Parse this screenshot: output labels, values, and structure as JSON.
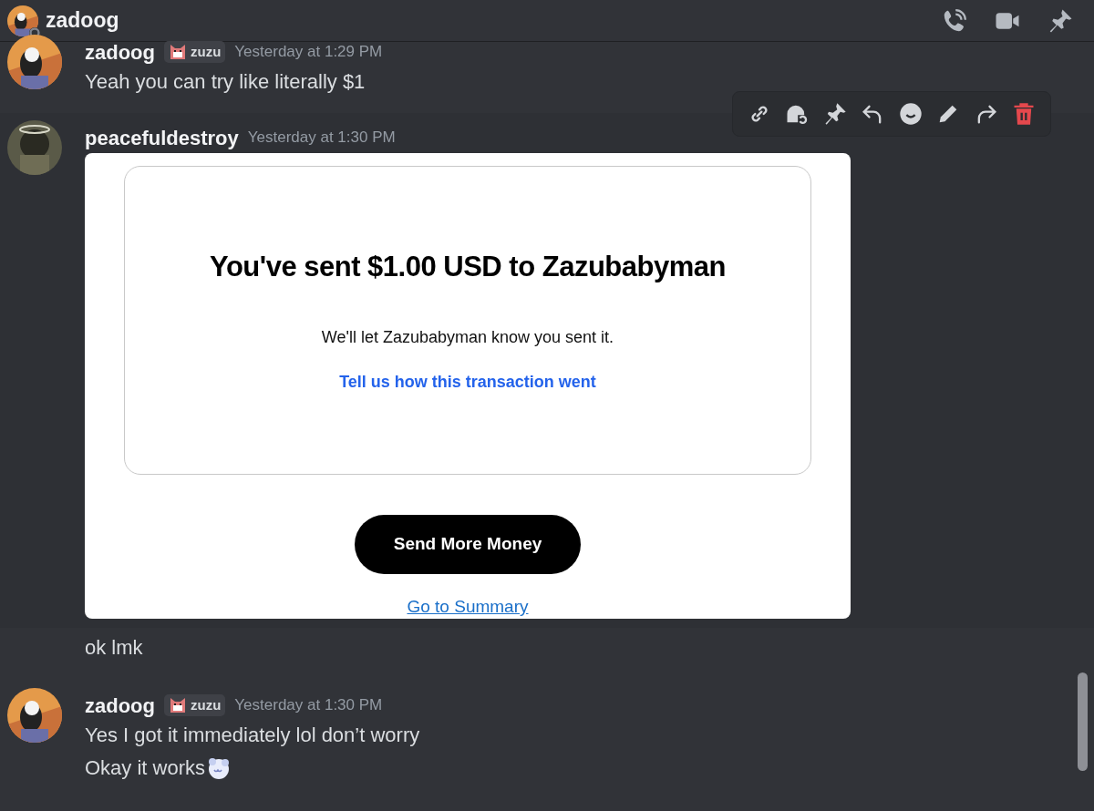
{
  "header": {
    "title": "zadoog"
  },
  "messages": [
    {
      "kind": "full",
      "author": "zadoog",
      "badge": "zuzu",
      "timestamp": "Yesterday at 1:29 PM",
      "hovered": false,
      "lines": [
        {
          "text": "Yeah you can try like literally $1",
          "emoji": false
        }
      ]
    },
    {
      "kind": "full",
      "author": "peacefuldestroy",
      "timestamp": "Yesterday at 1:30 PM",
      "hovered": true,
      "attachment": {
        "kind": "screenshot",
        "heading": "You've sent $1.00 USD to Zazubabyman",
        "subtext": "We'll let Zazubabyman know you sent it.",
        "feedback_link": "Tell us how this transaction went",
        "button": "Send More Money",
        "summary_link": "Go to Summary"
      }
    },
    {
      "kind": "continuation",
      "hovered": false,
      "lines": [
        {
          "text": "ok lmk",
          "emoji": false
        }
      ]
    },
    {
      "kind": "full",
      "author": "zadoog",
      "badge": "zuzu",
      "timestamp": "Yesterday at 1:30 PM",
      "hovered": false,
      "lines": [
        {
          "text": "Yes I got it immediately lol don’t worry",
          "emoji": false
        },
        {
          "text": "Okay it works",
          "emoji": true
        }
      ]
    }
  ]
}
